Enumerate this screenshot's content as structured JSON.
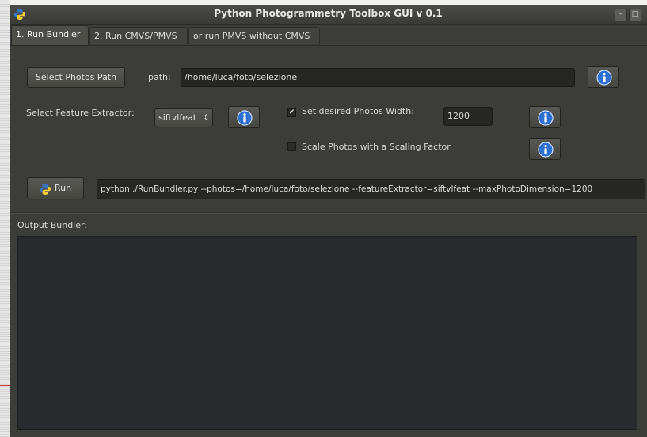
{
  "window": {
    "title": "Python Photogrammetry Toolbox GUI v 0.1",
    "minimize_glyph": "–",
    "maximize_glyph": "□"
  },
  "tabs": [
    {
      "label": "1. Run Bundler"
    },
    {
      "label": "2. Run CMVS/PMVS"
    },
    {
      "label": "or run PMVS without CMVS"
    }
  ],
  "bundler": {
    "select_photos_label": "Select Photos Path",
    "path_label": "path:",
    "path_value": "/home/luca/foto/selezione",
    "feature_extractor_label": "Select Feature Extractor:",
    "feature_extractor_value": "siftvlfeat",
    "set_width_label": "Set desired Photos Width:",
    "set_width_checked": true,
    "width_value": "1200",
    "scale_label": "Scale Photos with a Scaling Factor",
    "scale_checked": false,
    "run_label": "Run",
    "command_value": "python ./RunBundler.py --photos=/home/luca/foto/selezione --featureExtractor=siftvlfeat --maxPhotoDimension=1200",
    "output_label": "Output Bundler:",
    "output_text": ""
  },
  "icons": {
    "app": "python-logo-icon",
    "info": "info-icon",
    "combo_arrow": "⇕",
    "check": "✔"
  },
  "colors": {
    "info_blue": "#2f6fd0",
    "window_bg": "#3c3d38"
  }
}
